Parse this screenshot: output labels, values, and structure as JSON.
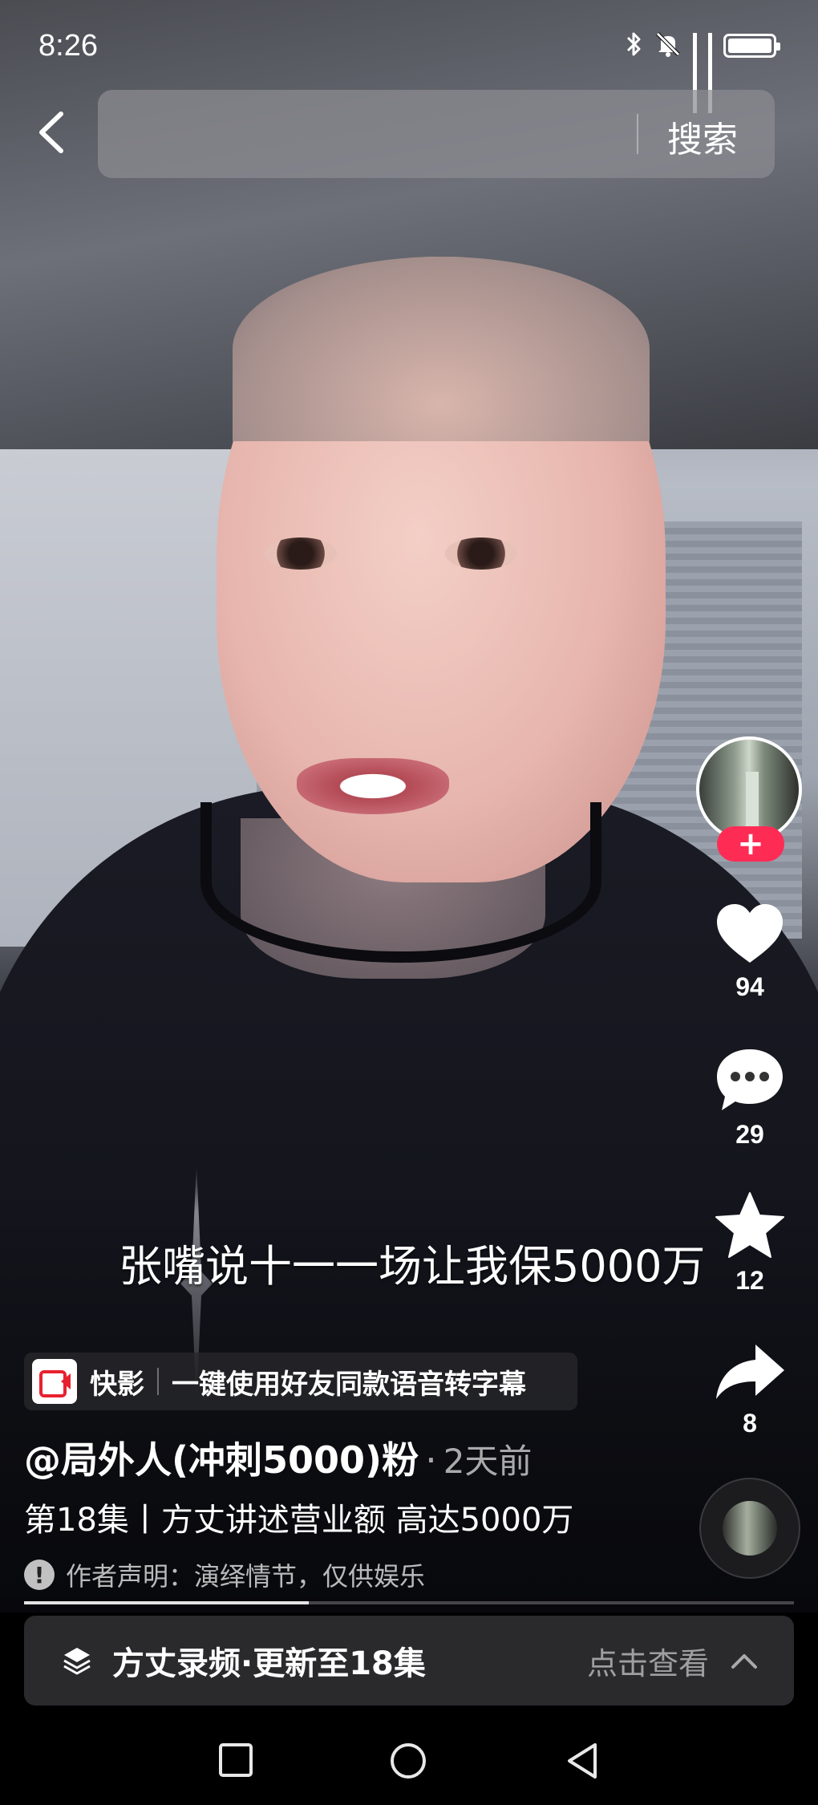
{
  "status_bar": {
    "time": "8:26",
    "icons": [
      "bluetooth-icon",
      "mute-icon",
      "signal-icon",
      "signal-icon",
      "battery-charging-icon"
    ]
  },
  "search": {
    "placeholder": "",
    "button_label": "搜索"
  },
  "video": {
    "subtitle": "张嘴说十一一场让我保5000万"
  },
  "actions": {
    "like_count": "94",
    "comment_count": "29",
    "favorite_count": "12",
    "share_count": "8",
    "follow_label": "+"
  },
  "promo": {
    "brand": "快影",
    "text": "一键使用好友同款语音转字幕"
  },
  "post": {
    "author": "@局外人(冲刺5000)粉",
    "separator": "·",
    "time_ago": "2天前",
    "caption": "第18集丨方丈讲述营业额 高达5000万",
    "disclaimer": "作者声明：演绎情节，仅供娱乐",
    "progress": 0.37
  },
  "series": {
    "title": "方丈录频·更新至18集",
    "view_label": "点击查看"
  },
  "colors": {
    "accent": "#fe2c55",
    "panel": "#2a2a2d"
  }
}
